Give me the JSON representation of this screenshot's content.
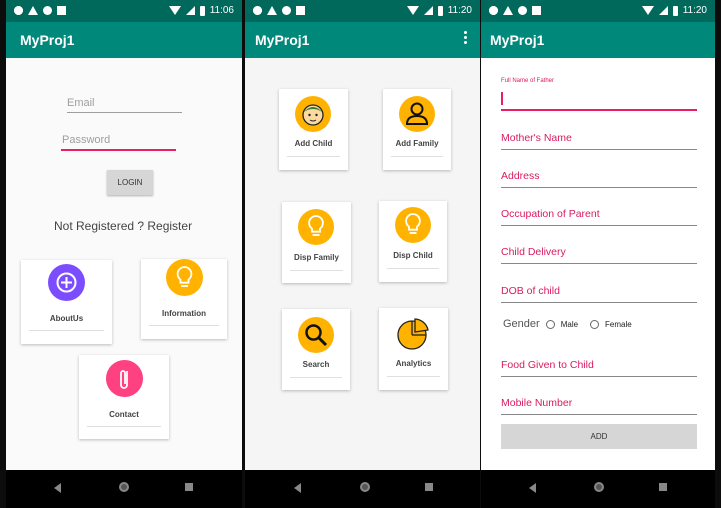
{
  "app_title": "MyProj1",
  "screens": {
    "s1": {
      "time": "11:06",
      "email_placeholder": "Email",
      "password_placeholder": "Password",
      "login_label": "LOGIN",
      "register_text": "Not Registered ? Register",
      "cards": [
        {
          "label": "AboutUs",
          "icon": "plus-circle-icon",
          "color": "#7c4dff"
        },
        {
          "label": "Information",
          "icon": "lightbulb-icon",
          "color": "#ffb300"
        },
        {
          "label": "Contact",
          "icon": "paperclip-icon",
          "color": "#ff4081"
        }
      ]
    },
    "s2": {
      "time": "11:20",
      "cards": [
        {
          "label": "Add Child",
          "icon": "child-face-icon"
        },
        {
          "label": "Add Family",
          "icon": "person-icon"
        },
        {
          "label": "Disp Family",
          "icon": "lightbulb-icon"
        },
        {
          "label": "Disp Child",
          "icon": "lightbulb-icon"
        },
        {
          "label": "Search",
          "icon": "search-icon"
        },
        {
          "label": "Analytics",
          "icon": "pie-chart-icon"
        }
      ]
    },
    "s3": {
      "time": "11:20",
      "father_label": "Full Name of Father",
      "fields": [
        "Mother's Name",
        "Address",
        "Occupation of Parent",
        "Child Delivery",
        "DOB of child"
      ],
      "gender_label": "Gender",
      "male_label": "Male",
      "female_label": "Female",
      "food_label": "Food Given to Child",
      "mobile_label": "Mobile Number",
      "add_label": "ADD"
    }
  },
  "colors": {
    "primary_dark": "#00695c",
    "primary": "#00897b",
    "accent": "#e91e63",
    "icon_yellow": "#ffb300"
  }
}
